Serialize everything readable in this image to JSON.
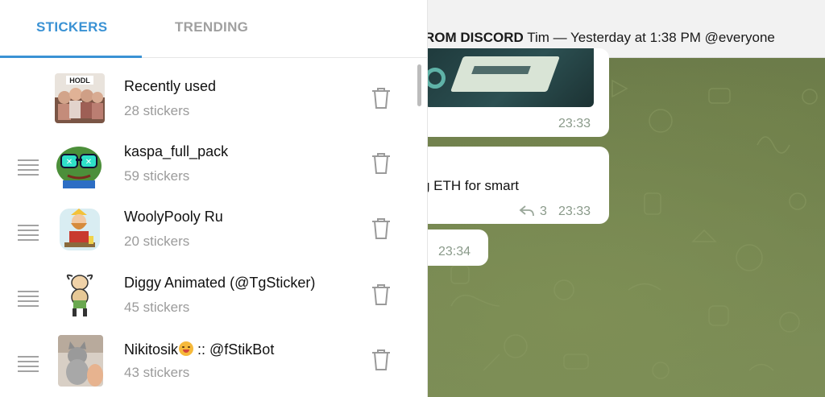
{
  "tabs": {
    "stickers_label": "STICKERS",
    "trending_label": "TRENDING",
    "active": "stickers"
  },
  "sticker_packs": [
    {
      "title": "Recently used",
      "count": "28 stickers",
      "thumb_icon": "hodl-group-photo-icon",
      "thumb_caption": "HODL"
    },
    {
      "title": "kaspa_full_pack",
      "count": "59 stickers",
      "thumb_icon": "pepe-frog-sunglasses-icon"
    },
    {
      "title": "WoolyPooly Ru",
      "count": "20 stickers",
      "thumb_icon": "bearded-man-cartoon-icon"
    },
    {
      "title": "Diggy Animated (@TgSticker)",
      "count": "45 stickers",
      "thumb_icon": "diggy-character-icon"
    },
    {
      "title_prefix": "Nikitosik",
      "title_emoji": "face-savoring-food-emoji",
      "title_suffix": " :: @fStikBot",
      "count": "43 stickers",
      "thumb_icon": "cat-photo-icon"
    }
  ],
  "chat": {
    "header_bold": "ROM DISCORD",
    "header_rest": " Tim — Yesterday at 1:38 PM @everyone",
    "messages": [
      {
        "time": "23:33"
      },
      {
        "text": "g ETH for smart",
        "replies": "3",
        "time": "23:33"
      },
      {
        "time": "23:34"
      }
    ]
  },
  "colors": {
    "accent": "#3a92d4",
    "muted_text": "#9b9b9b",
    "chat_header_bg": "#f2f2f2"
  }
}
